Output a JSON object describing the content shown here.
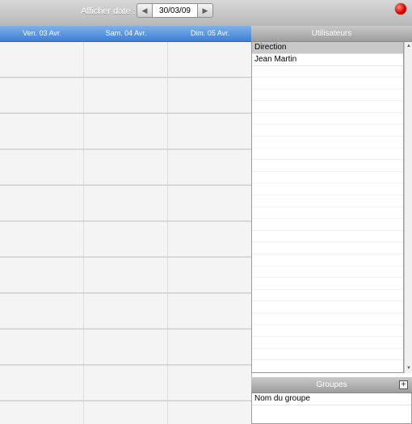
{
  "toolbar": {
    "date_label": "Afficher date :",
    "date_value": "30/03/09",
    "prev_icon": "◀",
    "next_icon": "▶"
  },
  "days": [
    "Ven. 03 Avr.",
    "Sam. 04 Avr.",
    "Dim. 05 Avr."
  ],
  "users_panel": {
    "title": "Utilisateurs",
    "rows": [
      "Direction",
      "Jean Martin"
    ],
    "selected_index": 0
  },
  "groups_panel": {
    "title": "Groupes",
    "add_label": "+",
    "rows": [
      "Nom du groupe"
    ]
  },
  "colors": {
    "header_blue": "#4a8ad9",
    "close_red": "#e00000"
  }
}
